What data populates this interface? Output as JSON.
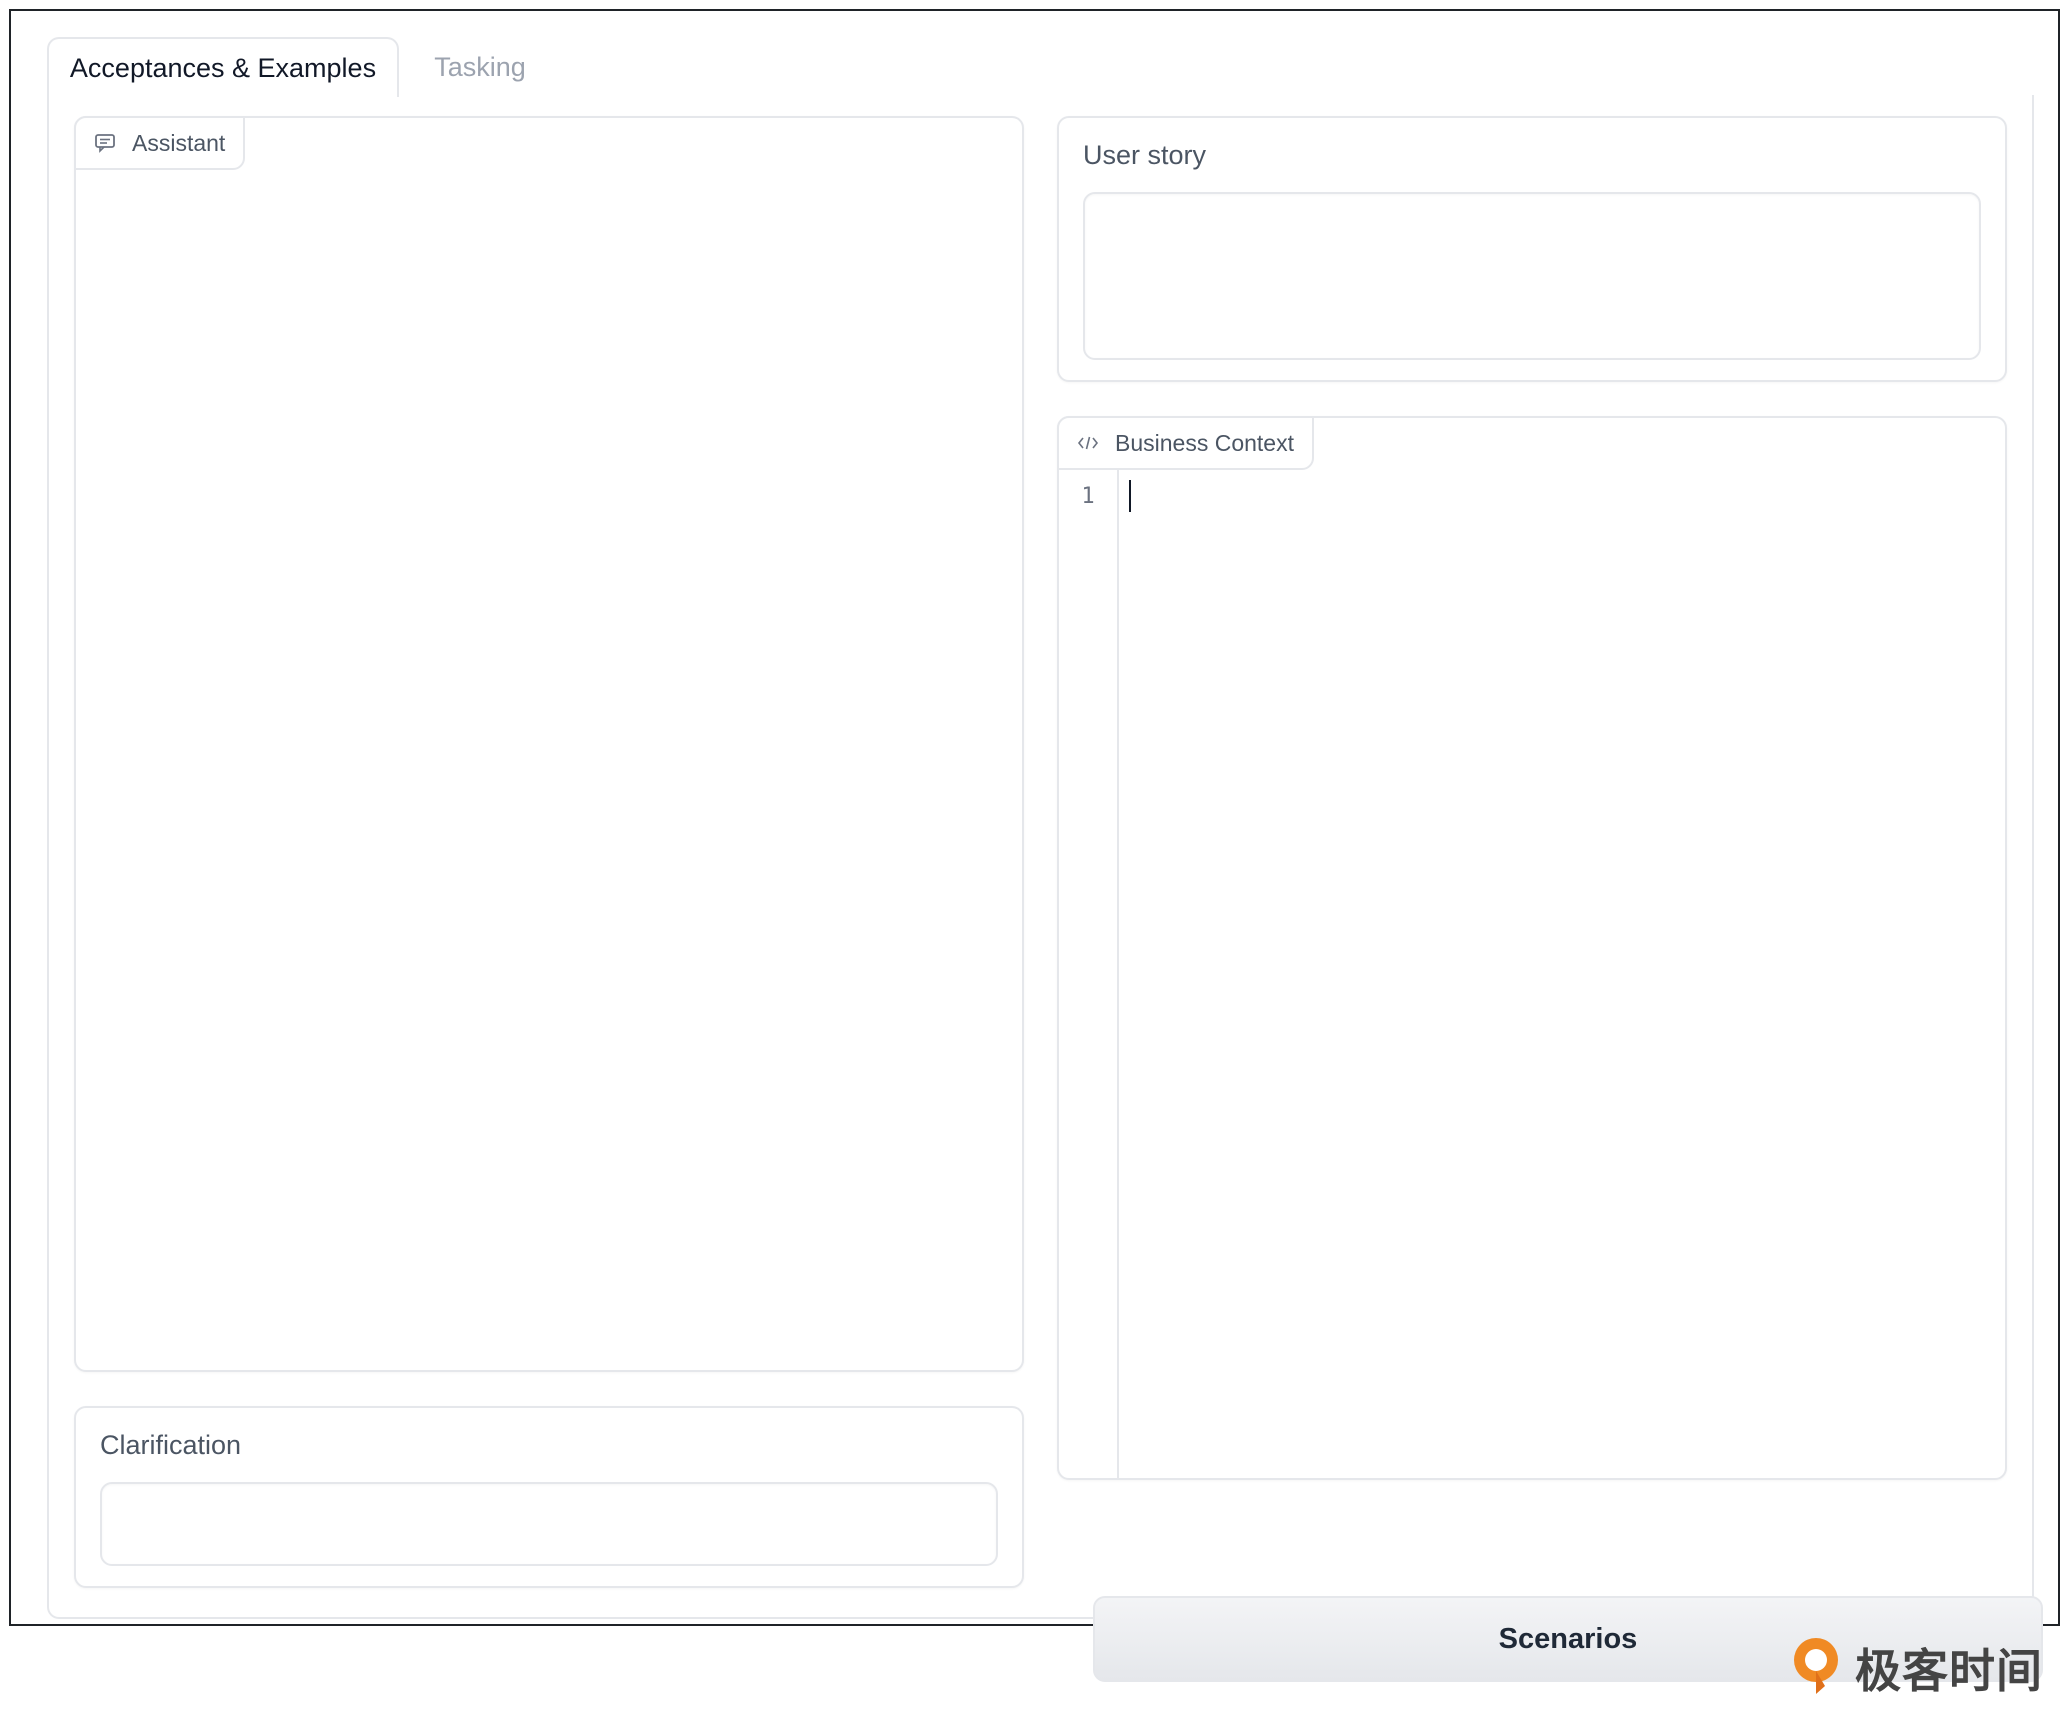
{
  "tabs": [
    {
      "label": "Acceptances & Examples",
      "active": true
    },
    {
      "label": "Tasking",
      "active": false
    }
  ],
  "assistant": {
    "label": "Assistant",
    "icon": "chat-icon"
  },
  "clarification": {
    "label": "Clarification",
    "value": ""
  },
  "user_story": {
    "label": "User story",
    "value": ""
  },
  "business_context": {
    "label": "Business Context",
    "icon": "code-icon",
    "line_numbers": [
      "1"
    ],
    "value": ""
  },
  "actions": {
    "scenarios_label": "Scenarios"
  },
  "watermark": {
    "text": "极客时间",
    "logo": "geektime-logo-icon",
    "accent_color": "#f08a24"
  },
  "colors": {
    "border": "#e5e7eb",
    "muted_text": "#9ca3af",
    "label_text": "#4b5563",
    "button_bg": "#f3f4f6"
  }
}
